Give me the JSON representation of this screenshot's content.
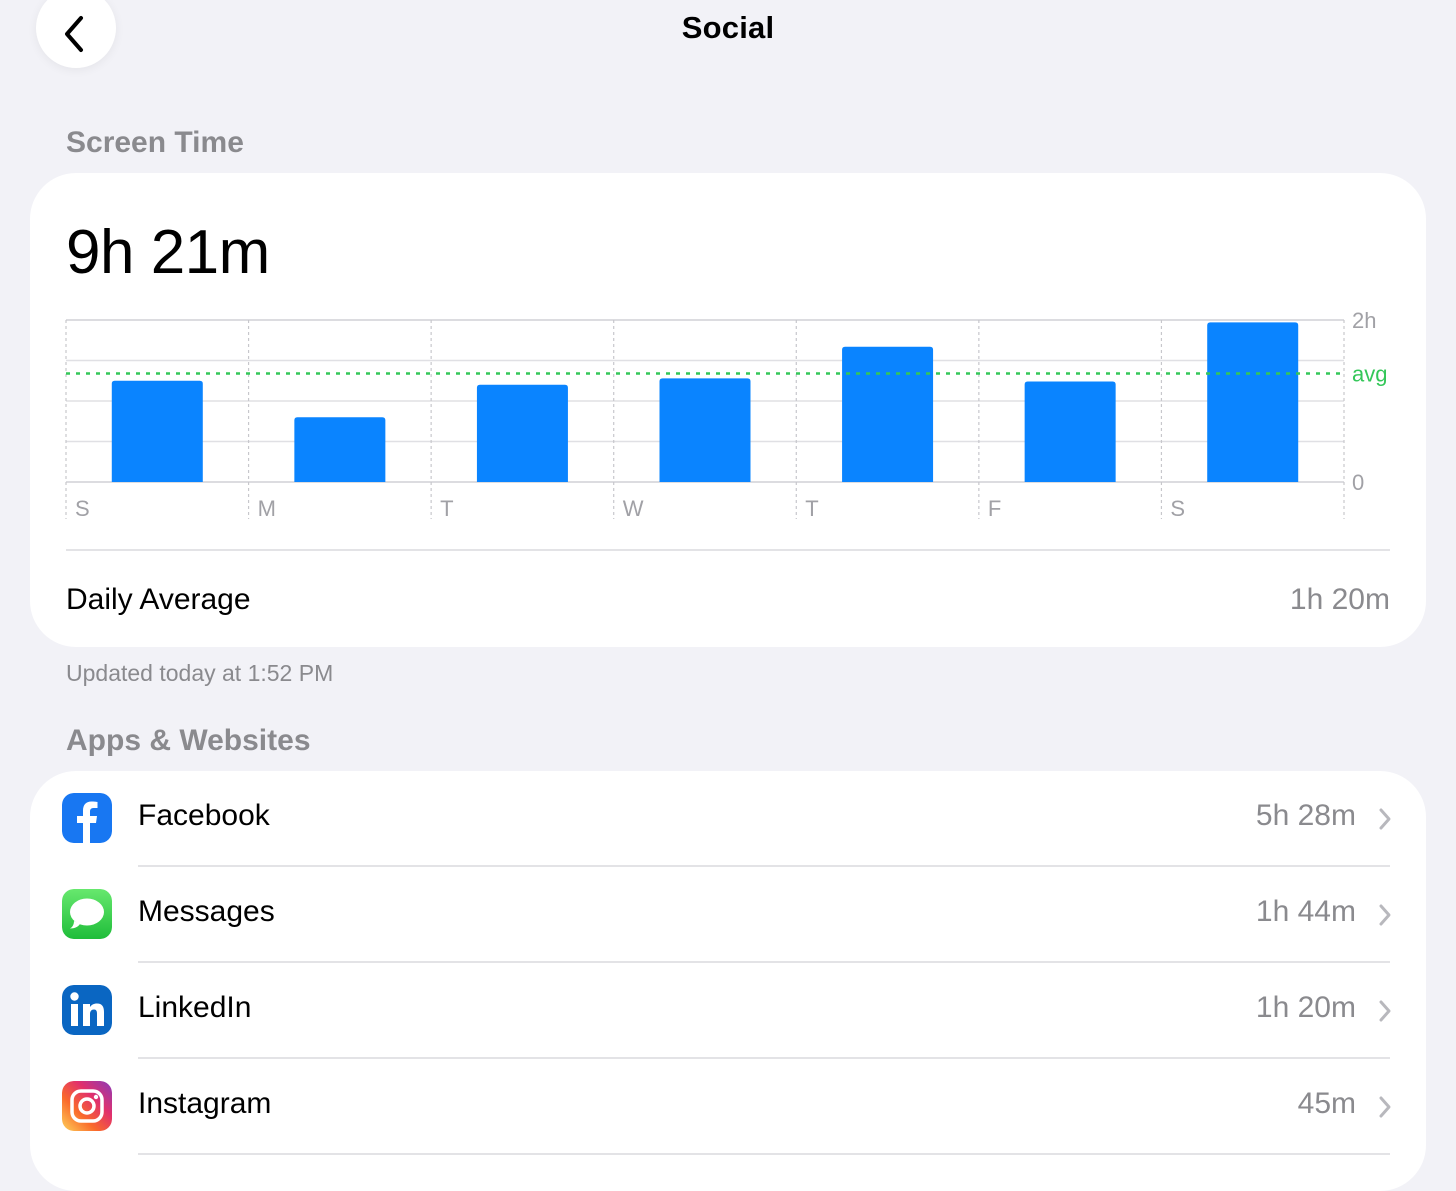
{
  "nav": {
    "title": "Social",
    "back_icon": "chevron-left-icon"
  },
  "screen_time": {
    "header": "Screen Time",
    "total": "9h 21m",
    "daily_average_label": "Daily Average",
    "daily_average_value": "1h 20m",
    "updated_text": "Updated today at 1:52 PM"
  },
  "chart_data": {
    "type": "bar",
    "categories": [
      "S",
      "M",
      "T",
      "W",
      "T",
      "F",
      "S"
    ],
    "values": [
      1.25,
      0.8,
      1.2,
      1.28,
      1.67,
      1.24,
      1.97
    ],
    "value_unit": "hours",
    "y_ticks": [
      "2h",
      "0"
    ],
    "ylim": [
      0,
      2
    ],
    "average_line": 1.34,
    "average_label": "avg",
    "bar_color": "#0a84ff",
    "average_color": "#34c759",
    "grid": true
  },
  "apps": {
    "header": "Apps & Websites",
    "items": [
      {
        "name": "Facebook",
        "time": "5h 28m",
        "icon": "facebook-icon"
      },
      {
        "name": "Messages",
        "time": "1h 44m",
        "icon": "messages-icon"
      },
      {
        "name": "LinkedIn",
        "time": "1h 20m",
        "icon": "linkedin-icon"
      },
      {
        "name": "Instagram",
        "time": "45m",
        "icon": "instagram-icon"
      }
    ]
  }
}
